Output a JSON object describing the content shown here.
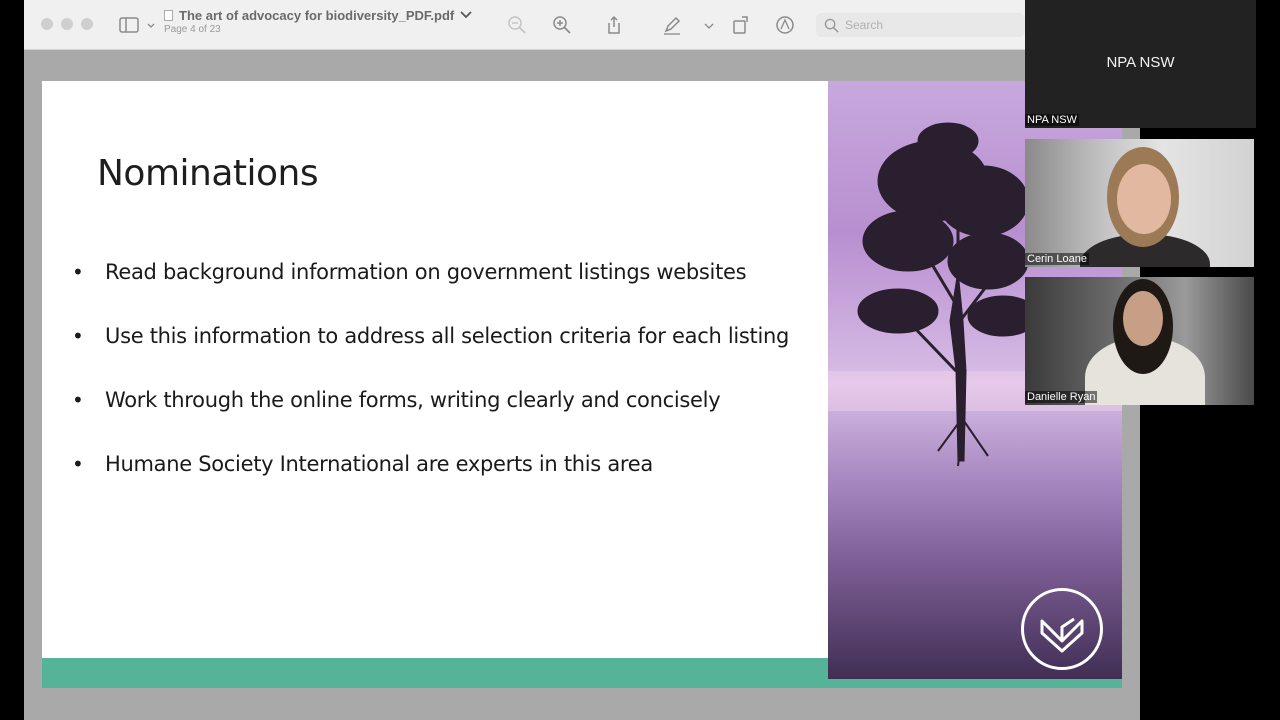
{
  "preview": {
    "document_title": "The art of advocacy for biodiversity_PDF.pdf",
    "page_indicator": "Page 4 of 23",
    "search_placeholder": "Search",
    "icons": [
      "sidebar-toggle-icon",
      "chevron-down-icon",
      "zoom-out-icon",
      "zoom-in-icon",
      "share-icon",
      "markup-pen-icon",
      "rotate-icon",
      "annotate-icon",
      "search-icon"
    ]
  },
  "slide": {
    "title": "Nominations",
    "bullets": [
      "Read background information on government listings websites",
      "Use this information to address all selection criteria for each listing",
      "Work through the online forms, writing clearly and concisely",
      "Humane Society International are experts in this area"
    ],
    "accent_color": "#55b497"
  },
  "video": {
    "host_tile_title": "NPA NSW",
    "host_tile_label": "NPA NSW",
    "participants": [
      {
        "name": "Cerin Loane"
      },
      {
        "name": "Danielle Ryan"
      }
    ]
  }
}
